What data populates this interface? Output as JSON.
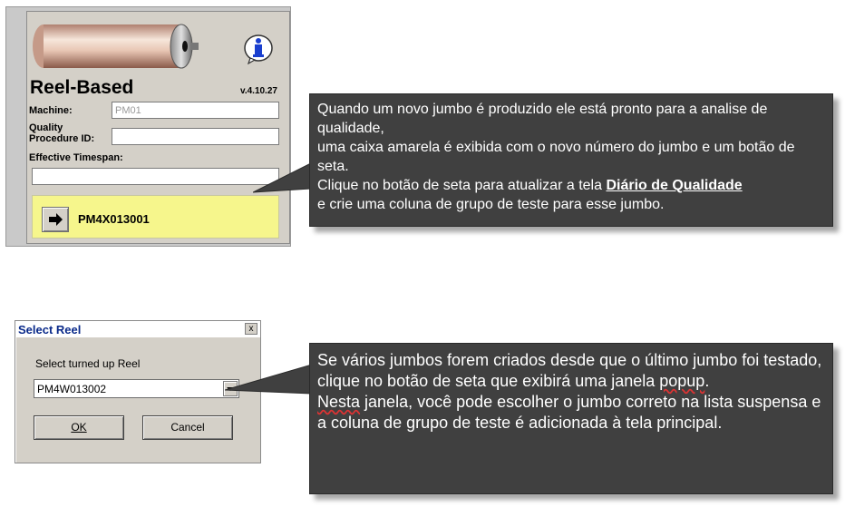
{
  "reel_panel": {
    "title": "Reel-Based",
    "version": "v.4.10.27",
    "machine_label": "Machine:",
    "machine_value": "PM01",
    "quality_label_1": "Quality",
    "quality_label_2": "Procedure ID:",
    "quality_value": "",
    "timespan_label": "Effective Timespan:",
    "timespan_value": "",
    "reel_id": "PM4X013001",
    "info_icon": "info-icon",
    "arrow_icon": "arrow-right-icon"
  },
  "callout1": {
    "line1": "Quando um novo jumbo é produzido ele está pronto para a analise de qualidade,",
    "line2": "uma caixa amarela é exibida com o novo número do jumbo e um botão de seta.",
    "line3_before": "Clique no botão de seta para atualizar a tela ",
    "line3_link": "Diário de Qualidade",
    "line4": "e crie uma coluna de grupo de teste para esse jumbo."
  },
  "dialog": {
    "title": "Select Reel",
    "close_label": "x",
    "label": "Select turned up Reel",
    "selected_value": "PM4W013002",
    "ok_label": "OK",
    "cancel_label": "Cancel"
  },
  "callout2": {
    "para1_before": "Se vários jumbos forem criados desde que o último jumbo foi testado, clique no botão de seta que exibirá uma janela ",
    "para1_word": "popup",
    "para1_after": ".",
    "para2_word": "Nesta",
    "para2_after": " janela, você pode escolher o jumbo correto na lista suspensa e a coluna de grupo de teste é adicionada à tela principal."
  },
  "colors": {
    "callout_bg": "#404040",
    "highlight_yellow": "#f6f68c",
    "dialog_title_text": "#0a2a8a"
  }
}
